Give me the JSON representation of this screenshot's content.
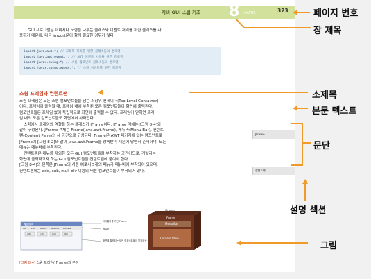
{
  "header": {
    "title": "자바 GUI 스윙 기초",
    "chapter_number": "8",
    "chapter_word": "CHAPTER",
    "page_number": "323"
  },
  "intro": {
    "line1": "GUI 프로그램은 이미지나 도형을 다루는 클래스와 이벤트 처리를 위한 클래스를 사",
    "line2": "용하기 때문에, 다음 import문이 함께 필요한 경우가 많다."
  },
  "code": [
    {
      "stmt": "import java.awt.*;",
      "comment": "// 그래픽 처리를 위한 클래스들의 경로명"
    },
    {
      "stmt": "import java.awt.event.*;",
      "comment": "// AWT 이벤트 사용을 위한 경로명"
    },
    {
      "stmt": "import javax.swing.*;",
      "comment": "// 스윙 컴포넌트 클래스들의 경로명"
    },
    {
      "stmt": "import javax.swing.event.*;",
      "comment": "// 스윙 이벤트를 위한 경로명"
    }
  ],
  "section": {
    "subheading": "스윙 프레임과 컨텐트팬",
    "para1": [
      "스윙 프레임은 모든 스윙 컴포넌트들을 담는 최상위 컨테이너(Top Level Container)",
      "이다. 프레임이 출력될 때, 프레임 내에 부착된 모든 컴포넌트들이 화면에 출력된다.",
      "컴포넌트들은 프레임 없이 독립적으로 화면에 출력될 수 없다. 프레임이 닫히면 프레",
      "임 내의 모든 컴포넌트들도 화면에서 사라진다."
    ],
    "para2": [
      "스윙에서 프레임의 역할을 하는 클래스가 JFrame이다. JFrame 객체는 [그림 8-4]와",
      "같이 구성된다. JFrame 객체는 Frame(java.awt.Frame), 메뉴바(Menu Bar), 컨텐트",
      "팬(Content Pane)의 세 공간으로 구성된다. Frame은 AWT 패키지에 있는 컴포넌트로",
      "JFrame이 [그림 8-2]와 같이 java.awt.Frame을 상속받기 때문에 당연히 존재하며, 모든",
      "메뉴는 메뉴바에 부착된다."
    ],
    "para3": [
      "컨텐트팬은 메뉴를 제외한 모든 GUI 컴포넌트들을 부착하는 공간이므로, 개발자는",
      "화면에 출력하고자 하는 GUI 컴포넌트들을 컨텐트팬에 붙여야 한다.",
      "[그림 8-4]의 왼쪽은 JFrame의 사용 예로서 5개의 메뉴가 메뉴바에 부착되어 있으며,",
      "컨텐트팬에는 add, sub, mul, div 이름의 버튼 컴포넌트들이 부착되어 있다."
    ]
  },
  "side_notes": {
    "jframe": "JFrame",
    "contentpane": "컨텐트팬"
  },
  "figure": {
    "window_title": "메뉴바 예",
    "menus": [
      "File",
      "Edit",
      "Source",
      "Refactor",
      "Window"
    ],
    "buttons": [
      "add",
      "sub",
      "mul",
      "div"
    ],
    "label_frame": "타이틀바를 가진 Frame",
    "label_menubar": "메뉴바",
    "label_content": "화면에 출력되는 모든 컴포넌트들이 부착되는 공간",
    "layer_jframe": "JFrame",
    "layer_frame": "Frame",
    "layer_menubar": "Menu Bar",
    "layer_content": "Content Pane",
    "caption_tag": "[그림 8-4]",
    "caption_text": "스윙 프레임(JFrame)의 구성"
  },
  "annotations": {
    "page_number": "페이지 번호",
    "chapter_title": "장 제목",
    "subheading": "소제목",
    "body_text": "본문 텍스트",
    "paragraph": "문단",
    "explanation_section": "설명 섹션",
    "figure": "그림"
  },
  "colors": {
    "header_green": "#d2e29c",
    "accent_orange": "#f09a2a",
    "heading_red": "#c8462a",
    "code_bg": "#e3edf5"
  }
}
